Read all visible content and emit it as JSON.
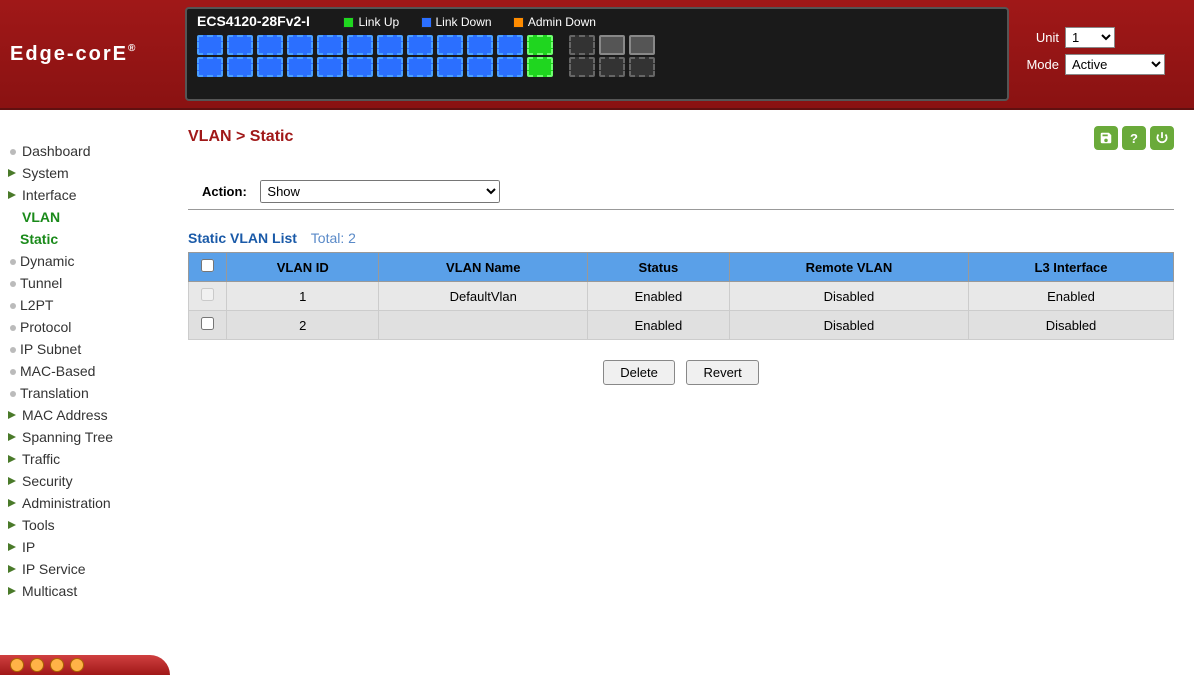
{
  "header": {
    "logo": "Edge-corE",
    "device_model": "ECS4120-28Fv2-I",
    "legend": {
      "link_up": "Link Up",
      "link_down": "Link Down",
      "admin_down": "Admin Down"
    },
    "unit_label": "Unit",
    "unit_value": "1",
    "mode_label": "Mode",
    "mode_value": "Active"
  },
  "sidebar": {
    "items": [
      {
        "label": "Dashboard",
        "type": "leaf"
      },
      {
        "label": "System",
        "type": "parent"
      },
      {
        "label": "Interface",
        "type": "parent"
      },
      {
        "label": "VLAN",
        "type": "expanded"
      },
      {
        "label": "Static",
        "type": "active",
        "sub": true
      },
      {
        "label": "Dynamic",
        "type": "leaf",
        "sub": true
      },
      {
        "label": "Tunnel",
        "type": "leaf",
        "sub": true
      },
      {
        "label": "L2PT",
        "type": "leaf",
        "sub": true
      },
      {
        "label": "Protocol",
        "type": "leaf",
        "sub": true
      },
      {
        "label": "IP Subnet",
        "type": "leaf",
        "sub": true
      },
      {
        "label": "MAC-Based",
        "type": "leaf",
        "sub": true
      },
      {
        "label": "Translation",
        "type": "leaf",
        "sub": true
      },
      {
        "label": "MAC Address",
        "type": "parent"
      },
      {
        "label": "Spanning Tree",
        "type": "parent"
      },
      {
        "label": "Traffic",
        "type": "parent"
      },
      {
        "label": "Security",
        "type": "parent"
      },
      {
        "label": "Administration",
        "type": "parent"
      },
      {
        "label": "Tools",
        "type": "parent"
      },
      {
        "label": "IP",
        "type": "parent"
      },
      {
        "label": "IP Service",
        "type": "parent"
      },
      {
        "label": "Multicast",
        "type": "parent"
      }
    ]
  },
  "content": {
    "breadcrumb": "VLAN > Static",
    "action_label": "Action:",
    "action_value": "Show",
    "list_title": "Static VLAN List",
    "total_label": "Total: 2",
    "columns": [
      "VLAN ID",
      "VLAN Name",
      "Status",
      "Remote VLAN",
      "L3 Interface"
    ],
    "rows": [
      {
        "checked": false,
        "disabled": true,
        "vlan_id": "1",
        "vlan_name": "DefaultVlan",
        "status": "Enabled",
        "remote": "Disabled",
        "l3": "Enabled"
      },
      {
        "checked": false,
        "disabled": false,
        "vlan_id": "2",
        "vlan_name": "",
        "status": "Enabled",
        "remote": "Disabled",
        "l3": "Disabled"
      }
    ],
    "delete_label": "Delete",
    "revert_label": "Revert"
  }
}
